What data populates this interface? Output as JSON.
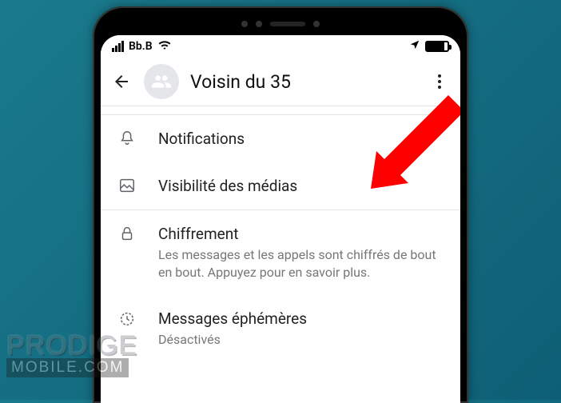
{
  "statusbar": {
    "carrier": "Bb.B"
  },
  "header": {
    "title": "Voisin du 35"
  },
  "items": {
    "notifications": {
      "title": "Notifications"
    },
    "media": {
      "title": "Visibilité des médias"
    },
    "encryption": {
      "title": "Chiffrement",
      "subtitle": "Les messages et les appels sont chiffrés de bout en bout. Appuyez pour en savoir plus."
    },
    "ephemeral": {
      "title": "Messages éphémères",
      "subtitle": "Désactivés"
    }
  },
  "watermark": {
    "line1": "PRODIGE",
    "line2": "MOBILE.COM"
  }
}
